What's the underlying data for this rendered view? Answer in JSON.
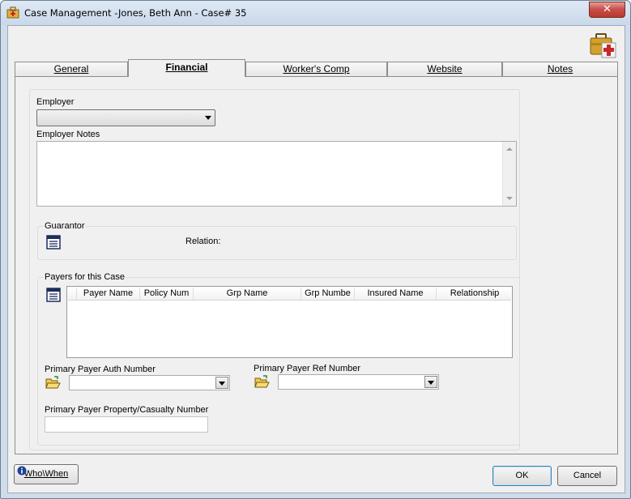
{
  "window": {
    "title": "Case Management -Jones, Beth Ann - Case#  35",
    "close_label": "✕"
  },
  "tabs": [
    {
      "label": "General",
      "active": false
    },
    {
      "label": "Financial",
      "active": true
    },
    {
      "label": "Worker's Comp",
      "active": false
    },
    {
      "label": "Website",
      "active": false
    },
    {
      "label": "Notes",
      "active": false
    }
  ],
  "financial": {
    "employer_label": "Employer",
    "employer_value": "",
    "employer_notes_label": "Employer Notes",
    "employer_notes_value": "",
    "guarantor": {
      "title": "Guarantor",
      "relation_label": "Relation:"
    },
    "payers": {
      "title": "Payers for this Case",
      "columns": [
        "Payer Name",
        "Policy Num",
        "Grp Name",
        "Grp Numbe",
        "Insured Name",
        "Relationship"
      ],
      "rows": []
    },
    "primary_auth_label": "Primary Payer Auth Number",
    "primary_auth_value": "",
    "primary_ref_label": "Primary Payer Ref Number",
    "primary_ref_value": "",
    "property_casualty_label": "Primary Payer Property/Casualty Number",
    "property_casualty_value": ""
  },
  "footer": {
    "who_when_label": "Who\\When",
    "ok_label": "OK",
    "cancel_label": "Cancel"
  },
  "icons": {
    "app": "case-folder-icon",
    "toolbox": "medical-toolbox-icon",
    "record": "record-list-icon",
    "folder": "open-folder-icon",
    "info": "info-icon"
  }
}
